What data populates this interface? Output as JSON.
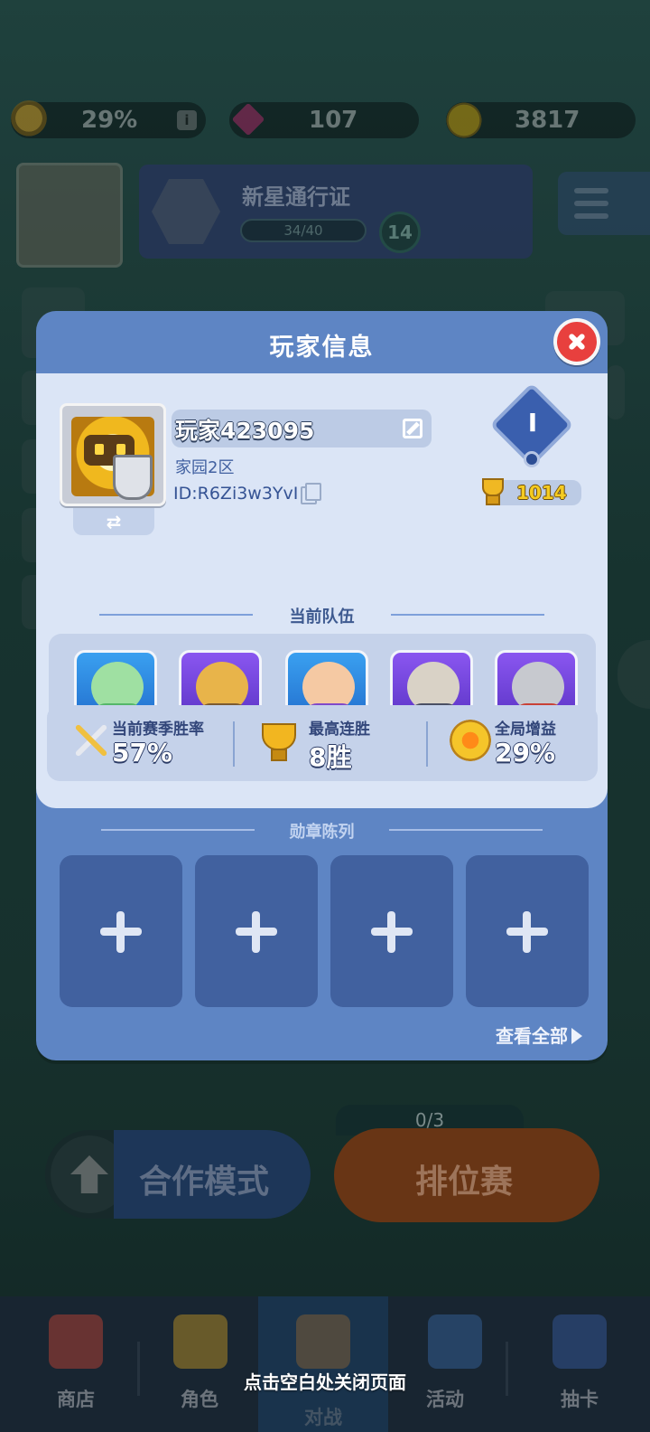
{
  "background": {
    "resources": {
      "buff_percent": "29%",
      "gems": "107",
      "coins": "3817"
    },
    "pass": {
      "title": "新星通行证",
      "progress_text": "34/40",
      "level": "14"
    },
    "modes": {
      "coop_label": "合作模式",
      "ranked_label": "排位赛",
      "ranked_count": "0/3"
    },
    "nav": {
      "tabs": [
        {
          "label": "商店"
        },
        {
          "label": "角色"
        },
        {
          "label": "对战"
        },
        {
          "label": "活动"
        },
        {
          "label": "抽卡"
        }
      ]
    }
  },
  "modal": {
    "title": "玩家信息",
    "player": {
      "name": "玩家423095",
      "server": "家园2区",
      "id_text": "ID:R6Zi3w3YvI",
      "rank_numeral": "I",
      "trophies": "1014"
    },
    "team": {
      "heading": "当前队伍",
      "heroes": [
        {
          "icon": "green-sprite-hero"
        },
        {
          "icon": "goblin-engineer-hero"
        },
        {
          "icon": "mage-kid-hero"
        },
        {
          "icon": "dark-knight-hero"
        },
        {
          "icon": "armored-knight-hero"
        }
      ]
    },
    "stats": [
      {
        "label": "当前赛季胜率",
        "value": "57%",
        "icon": "crossed-swords-icon"
      },
      {
        "label": "最高连胜",
        "value": "8胜",
        "icon": "trophy-cup-icon"
      },
      {
        "label": "全局增益",
        "value": "29%",
        "icon": "crown-buff-icon"
      }
    ],
    "medals": {
      "heading": "勋章陈列",
      "slots": 4,
      "view_all": "查看全部"
    }
  },
  "close_hint": "点击空白处关闭页面",
  "colors": {
    "modal_frame": "#5e85c4",
    "modal_inner": "#dbe5f6",
    "close_button": "#e8403e",
    "medal_slot": "#41619f"
  }
}
